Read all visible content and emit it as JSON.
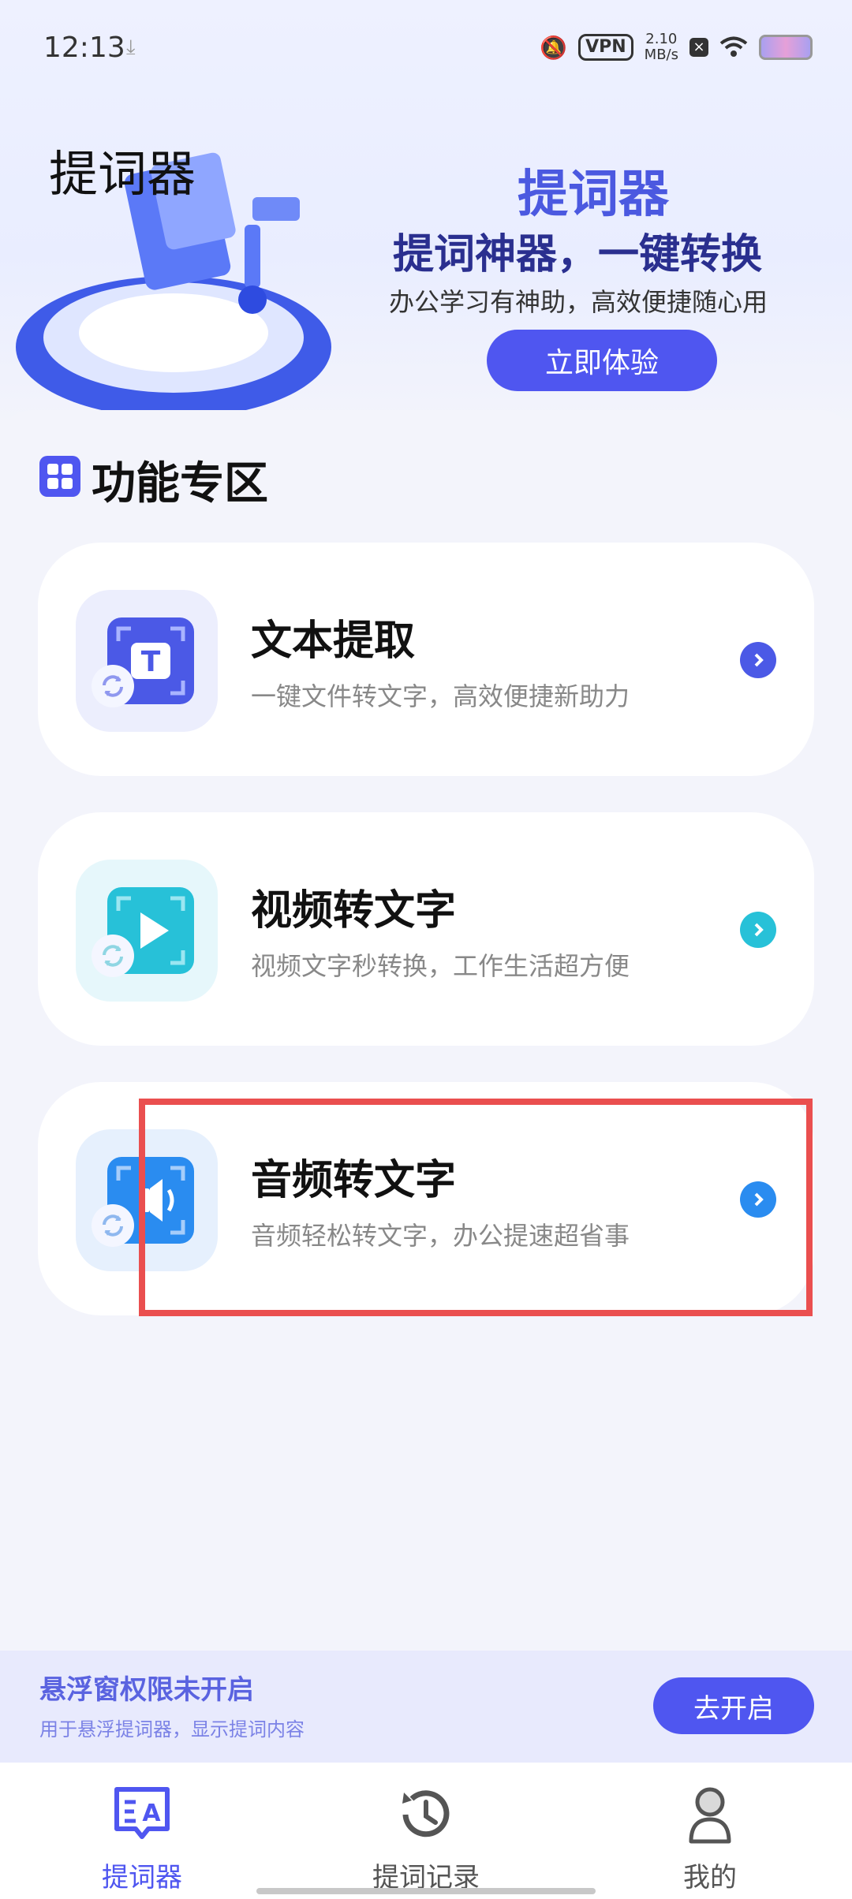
{
  "status_bar": {
    "time": "12:13",
    "download_icon": "download-icon",
    "vpn_label": "VPN",
    "speed_value": "2.10",
    "speed_unit": "MB/s"
  },
  "header": {
    "title": "提词器",
    "banner": {
      "brand": "提词器",
      "slogan": "提词神器，一键转换",
      "subtitle": "办公学习有神助，高效便捷随心用",
      "cta_label": "立即体验"
    }
  },
  "section": {
    "title": "功能专区"
  },
  "features": [
    {
      "title": "文本提取",
      "desc": "一键文件转文字，高效便捷新助力",
      "icon": "text-extract-icon",
      "accent": "#4b59e6"
    },
    {
      "title": "视频转文字",
      "desc": "视频文字秒转换，工作生活超方便",
      "icon": "video-play-icon",
      "accent": "#27c1d8"
    },
    {
      "title": "音频转文字",
      "desc": "音频轻松转文字，办公提速超省事",
      "icon": "audio-icon",
      "accent": "#2a8cf0"
    }
  ],
  "float_permission": {
    "title": "悬浮窗权限未开启",
    "subtitle": "用于悬浮提词器，显示提词内容",
    "button_label": "去开启"
  },
  "tabbar": {
    "items": [
      {
        "label": "提词器",
        "icon": "teleprompter-icon",
        "active": true
      },
      {
        "label": "提词记录",
        "icon": "history-icon",
        "active": false
      },
      {
        "label": "我的",
        "icon": "profile-icon",
        "active": false
      }
    ]
  },
  "colors": {
    "primary": "#4f56f0",
    "highlight_box": "#ea4f4f"
  }
}
